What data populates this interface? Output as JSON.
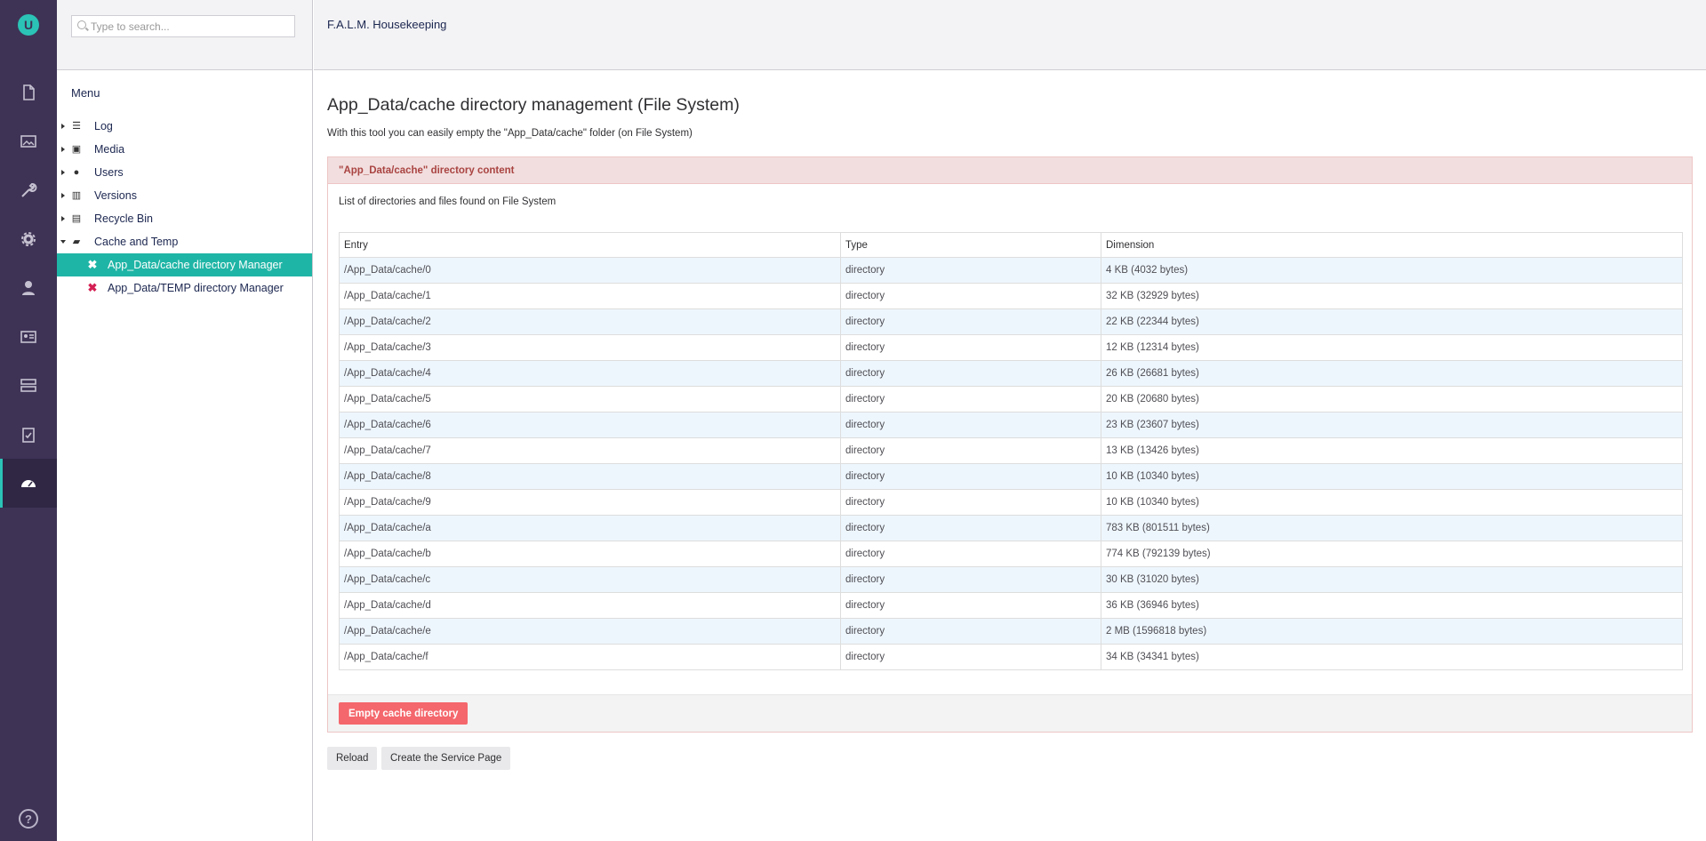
{
  "rail": {
    "logo_letter": "U",
    "sections": [
      "content-icon",
      "media-icon",
      "settings-icon",
      "packages-icon",
      "users-icon",
      "members-icon",
      "forms-icon",
      "translation-icon",
      "falm-icon"
    ],
    "help_glyph": "?"
  },
  "tree": {
    "search_placeholder": "Type to search...",
    "menu_title": "Menu",
    "nodes": [
      {
        "label": "Log",
        "icon": "list-icon"
      },
      {
        "label": "Media",
        "icon": "image-icon"
      },
      {
        "label": "Users",
        "icon": "users-icon"
      },
      {
        "label": "Versions",
        "icon": "books-icon"
      },
      {
        "label": "Recycle Bin",
        "icon": "trash-icon"
      },
      {
        "label": "Cache and Temp",
        "icon": "folder-open-icon"
      }
    ],
    "children": [
      {
        "label": "App_Data/cache directory Manager"
      },
      {
        "label": "App_Data/TEMP directory Manager"
      }
    ]
  },
  "header": {
    "title": "F.A.L.M. Housekeeping"
  },
  "main": {
    "title": "App_Data/cache directory management (File System)",
    "description": "With this tool you can easily empty the \"App_Data/cache\" folder (on File System)",
    "panel_title": "\"App_Data/cache\" directory content",
    "panel_description": "List of directories and files found on File System",
    "columns": [
      "Entry",
      "Type",
      "Dimension"
    ],
    "rows": [
      [
        "/App_Data/cache/0",
        "directory",
        "4 KB (4032 bytes)"
      ],
      [
        "/App_Data/cache/1",
        "directory",
        "32 KB (32929 bytes)"
      ],
      [
        "/App_Data/cache/2",
        "directory",
        "22 KB (22344 bytes)"
      ],
      [
        "/App_Data/cache/3",
        "directory",
        "12 KB (12314 bytes)"
      ],
      [
        "/App_Data/cache/4",
        "directory",
        "26 KB (26681 bytes)"
      ],
      [
        "/App_Data/cache/5",
        "directory",
        "20 KB (20680 bytes)"
      ],
      [
        "/App_Data/cache/6",
        "directory",
        "23 KB (23607 bytes)"
      ],
      [
        "/App_Data/cache/7",
        "directory",
        "13 KB (13426 bytes)"
      ],
      [
        "/App_Data/cache/8",
        "directory",
        "10 KB (10340 bytes)"
      ],
      [
        "/App_Data/cache/9",
        "directory",
        "10 KB (10340 bytes)"
      ],
      [
        "/App_Data/cache/a",
        "directory",
        "783 KB (801511 bytes)"
      ],
      [
        "/App_Data/cache/b",
        "directory",
        "774 KB (792139 bytes)"
      ],
      [
        "/App_Data/cache/c",
        "directory",
        "30 KB (31020 bytes)"
      ],
      [
        "/App_Data/cache/d",
        "directory",
        "36 KB (36946 bytes)"
      ],
      [
        "/App_Data/cache/e",
        "directory",
        "2 MB (1596818 bytes)"
      ],
      [
        "/App_Data/cache/f",
        "directory",
        "34 KB (34341 bytes)"
      ]
    ],
    "empty_button": "Empty cache directory",
    "reload_button": "Reload",
    "service_button": "Create the Service Page"
  },
  "colors": {
    "rail": "#3e3355",
    "accent": "#1fb5a6",
    "danger": "#f4676c",
    "panel_head": "#f2dede"
  }
}
